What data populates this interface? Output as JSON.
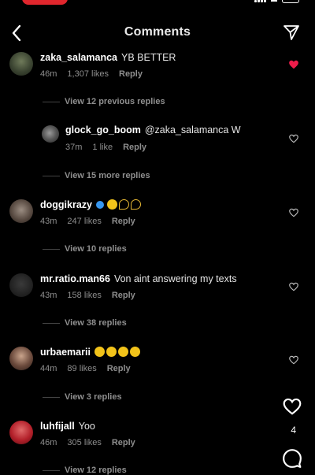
{
  "header": {
    "title": "Comments"
  },
  "comments": [
    {
      "username": "zaka_salamanca",
      "text": "YB BETTER",
      "time": "46m",
      "likes": "1,307 likes",
      "reply": "Reply",
      "liked": true
    },
    {
      "username": "glock_go_boom",
      "text": "@zaka_salamanca W",
      "time": "37m",
      "likes": "1 like",
      "reply": "Reply",
      "liked": false
    },
    {
      "username": "doggikrazy",
      "text": "",
      "time": "43m",
      "likes": "247 likes",
      "reply": "Reply",
      "liked": false,
      "verified": true
    },
    {
      "username": "mr.ratio.man66",
      "text": "Von aint answering my texts",
      "time": "43m",
      "likes": "158 likes",
      "reply": "Reply",
      "liked": false
    },
    {
      "username": "urbaemarii",
      "text": "",
      "time": "44m",
      "likes": "89 likes",
      "reply": "Reply",
      "liked": false
    },
    {
      "username": "luhfijall",
      "text": "Yoo",
      "time": "46m",
      "likes": "305 likes",
      "reply": "Reply",
      "liked": false
    }
  ],
  "view_replies": [
    "View 12 previous replies",
    "View 15 more replies",
    "View 10 replies",
    "View 38 replies",
    "View 3 replies",
    "View 12 replies"
  ],
  "rail": {
    "count": "4"
  },
  "colors": {
    "like_red": "#ed1c4a",
    "muted": "#8e8e8e",
    "verified_blue": "#3797f0"
  }
}
